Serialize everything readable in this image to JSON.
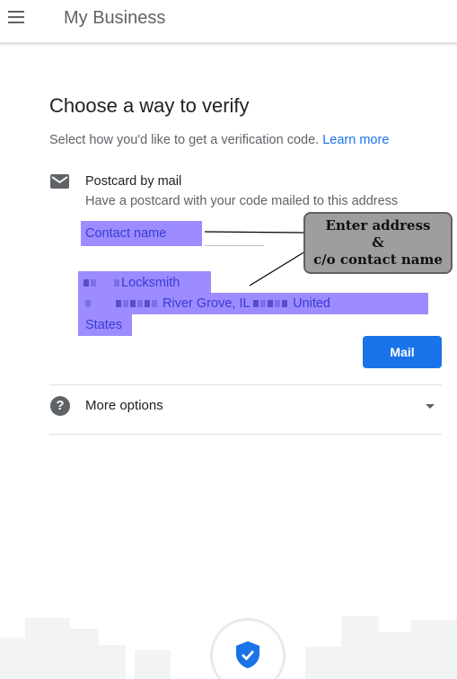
{
  "appbar": {
    "title": "My Business"
  },
  "main": {
    "heading": "Choose a way to verify",
    "subtext": "Select how you'd like to get a verification code.",
    "learn_more": "Learn more"
  },
  "postcard_option": {
    "title": "Postcard by mail",
    "description": "Have a postcard with your code mailed to this address",
    "contact_placeholder": "Contact name",
    "business_name": "Locksmith",
    "address_city": "River Grove, IL",
    "address_country_part1": "United",
    "address_country_part2": "States",
    "mail_button": "Mail"
  },
  "more_options": {
    "label": "More options"
  },
  "annotation": {
    "line1": "Enter address",
    "line2": "&",
    "line3": "c/o contact name"
  },
  "colors": {
    "accent": "#1a73e8",
    "highlight": "#9c8cff"
  },
  "icons": [
    "menu-icon",
    "mail-icon",
    "help-icon",
    "caret-down-icon",
    "shield-check-icon"
  ]
}
